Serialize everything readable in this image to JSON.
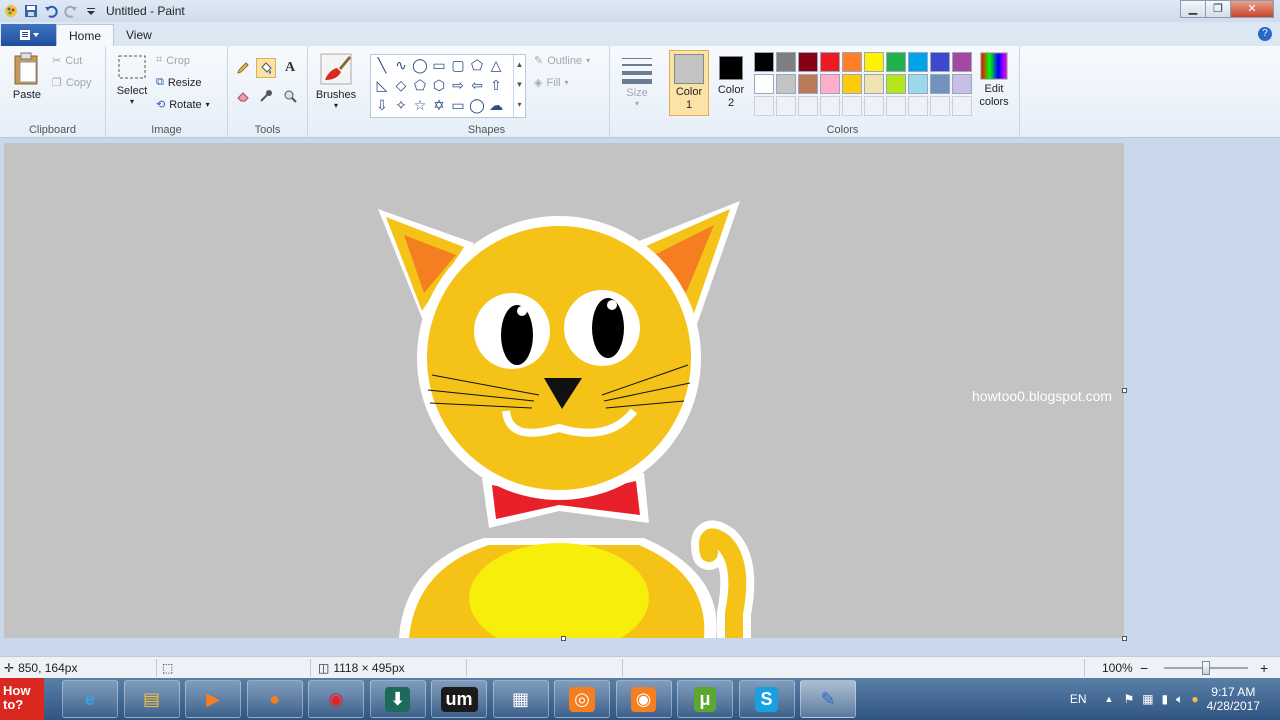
{
  "window": {
    "title": "Untitled - Paint",
    "minimize": "▁",
    "restore": "❐",
    "close": "✕"
  },
  "tabs": [
    {
      "label": "Home"
    },
    {
      "label": "View"
    }
  ],
  "help_label": "?",
  "ribbon": {
    "clipboard": {
      "label": "Clipboard",
      "paste": "Paste",
      "cut": "Cut",
      "copy": "Copy"
    },
    "image": {
      "label": "Image",
      "select": "Select",
      "crop": "Crop",
      "resize": "Resize",
      "rotate": "Rotate"
    },
    "tools": {
      "label": "Tools"
    },
    "brushes": {
      "label": "Brushes"
    },
    "shapes": {
      "label": "Shapes",
      "outline": "Outline",
      "fill": "Fill"
    },
    "size": {
      "label": "Size"
    },
    "colors": {
      "label": "Colors",
      "color1": "Color 1",
      "color2": "Color 2",
      "edit": "Edit colors",
      "color1_value": "#c3c3c3",
      "color2_value": "#000000",
      "palette_row1": [
        "#000000",
        "#7f7f7f",
        "#880015",
        "#ed1c24",
        "#ff7f27",
        "#fff200",
        "#22b14c",
        "#00a2e8",
        "#3f48cc",
        "#a349a4"
      ],
      "palette_row2": [
        "#ffffff",
        "#c3c3c3",
        "#b97a57",
        "#ffaec9",
        "#ffc90e",
        "#efe4b0",
        "#b5e61d",
        "#99d9ea",
        "#7092be",
        "#c8bfe7"
      ]
    }
  },
  "canvas": {
    "watermark": "howtoo0.blogspot.com"
  },
  "status": {
    "cursor_pos": "850, 164px",
    "canvas_size": "1118 × 495px",
    "zoom": "100%",
    "zoom_out": "−",
    "zoom_in": "+"
  },
  "taskbar": {
    "start_label_1": "How",
    "start_label_2": "to?",
    "apps": [
      "internet-explorer-icon",
      "file-explorer-icon",
      "media-player-icon",
      "firefox-icon",
      "chrome-icon",
      "download-manager-icon",
      "ummy-icon",
      "video-editor-icon",
      "screen-recorder-icon",
      "camera-icon",
      "utorrent-icon",
      "skype-icon",
      "paint-icon"
    ],
    "language": "EN",
    "time": "9:17 AM",
    "date": "4/28/2017"
  }
}
